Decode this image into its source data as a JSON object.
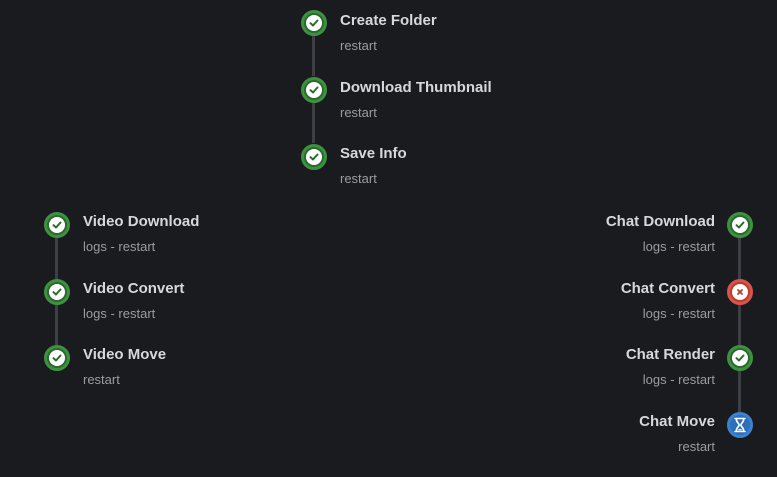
{
  "groups": {
    "prepare": {
      "steps": [
        {
          "title": "Create Folder",
          "status": "success",
          "actions": [
            "restart"
          ]
        },
        {
          "title": "Download Thumbnail",
          "status": "success",
          "actions": [
            "restart"
          ]
        },
        {
          "title": "Save Info",
          "status": "success",
          "actions": [
            "restart"
          ]
        }
      ]
    },
    "video": {
      "steps": [
        {
          "title": "Video Download",
          "status": "success",
          "actions": [
            "logs",
            "restart"
          ]
        },
        {
          "title": "Video Convert",
          "status": "success",
          "actions": [
            "logs",
            "restart"
          ]
        },
        {
          "title": "Video Move",
          "status": "success",
          "actions": [
            "restart"
          ]
        }
      ]
    },
    "chat": {
      "steps": [
        {
          "title": "Chat Download",
          "status": "success",
          "actions": [
            "logs",
            "restart"
          ]
        },
        {
          "title": "Chat Convert",
          "status": "error",
          "actions": [
            "logs",
            "restart"
          ]
        },
        {
          "title": "Chat Render",
          "status": "success",
          "actions": [
            "logs",
            "restart"
          ]
        },
        {
          "title": "Chat Move",
          "status": "pending",
          "actions": [
            "restart"
          ]
        }
      ]
    }
  },
  "action_separator": " - ",
  "icons": {
    "success": "check-circle-icon",
    "error": "x-circle-icon",
    "pending": "hourglass-icon"
  },
  "colors": {
    "background": "#1a1b1e",
    "success": "#3f9142",
    "error": "#d9534f",
    "pending": "#3b82d0",
    "title": "#d6d8dc",
    "muted": "#9a9ca1"
  }
}
